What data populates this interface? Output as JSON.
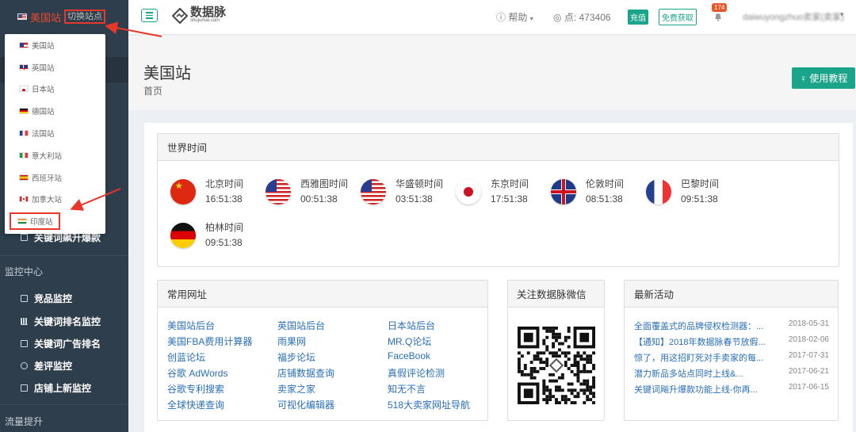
{
  "site": {
    "current": "美国站",
    "switch_label": "切换站点"
  },
  "site_dropdown": [
    {
      "label": "美国站",
      "flag": "us"
    },
    {
      "label": "英国站",
      "flag": "gb"
    },
    {
      "label": "日本站",
      "flag": "jp"
    },
    {
      "label": "德国站",
      "flag": "de"
    },
    {
      "label": "法国站",
      "flag": "fr"
    },
    {
      "label": "意大利站",
      "flag": "it"
    },
    {
      "label": "西班牙站",
      "flag": "es"
    },
    {
      "label": "加拿大站",
      "flag": "ca"
    },
    {
      "label": "印度站",
      "flag": "in",
      "highlighted": true
    }
  ],
  "sidebar": {
    "partial_item": "关键词飙升爆款",
    "section_monitor": "监控中心",
    "monitor_items": [
      "竞品监控",
      "关键词排名监控",
      "关键词广告排名",
      "差评监控",
      "店铺上新监控"
    ],
    "section_traffic": "流量提升"
  },
  "topbar": {
    "logo_text": "数据脉",
    "logo_sub": "shujumai.com",
    "help_label": "帮助",
    "points_label": "点: 473406",
    "charge_label": "充值",
    "free_label": "免费获取",
    "notification_count": "174",
    "user_name": "daiwuyongzhuo卖家(卖家)"
  },
  "page": {
    "title": "美国站",
    "breadcrumb": "首页",
    "guide_button": "使用教程"
  },
  "world_time": {
    "title": "世界时间",
    "clocks": [
      {
        "city": "北京时间",
        "time": "16:51:38",
        "flag": "cn"
      },
      {
        "city": "西雅图时间",
        "time": "00:51:38",
        "flag": "us"
      },
      {
        "city": "华盛顿时间",
        "time": "03:51:38",
        "flag": "us"
      },
      {
        "city": "东京时间",
        "time": "17:51:38",
        "flag": "jp"
      },
      {
        "city": "伦敦时间",
        "time": "08:51:38",
        "flag": "gb"
      },
      {
        "city": "巴黎时间",
        "time": "09:51:38",
        "flag": "fr"
      },
      {
        "city": "柏林时间",
        "time": "09:51:38",
        "flag": "de"
      }
    ]
  },
  "common_links": {
    "title": "常用网址",
    "col1": [
      "美国站后台",
      "美国FBA费用计算器",
      "创蓝论坛",
      "谷歌 AdWords",
      "谷歌专利搜索",
      "全球快递查询"
    ],
    "col2": [
      "英国站后台",
      "雨果网",
      "福步论坛",
      "店铺数据查询",
      "卖家之家",
      "可视化编辑器"
    ],
    "col3": [
      "日本站后台",
      "MR.Q论坛",
      "FaceBook",
      "真假评论检测",
      "知无不言",
      "518大卖家网址导航"
    ]
  },
  "wechat": {
    "title": "关注数据脉微信"
  },
  "news": {
    "title": "最新活动",
    "items": [
      {
        "title": "全面覆盖式的品牌侵权检测器：...",
        "date": "2018-05-31"
      },
      {
        "title": "【通知】2018年数据脉春节放假...",
        "date": "2018-02-06"
      },
      {
        "title": "惊了，用这招盯死对手卖家的每...",
        "date": "2017-07-31"
      },
      {
        "title": "潜力新品多站点同时上线&...",
        "date": "2017-06-21"
      },
      {
        "title": "关键词飚升爆款功能上线-你再...",
        "date": "2017-06-15"
      }
    ]
  },
  "colors": {
    "accent": "#1aa58a",
    "sidebar": "#2f3e4c",
    "annotation": "#e8362a",
    "link": "#2a6fb8"
  }
}
